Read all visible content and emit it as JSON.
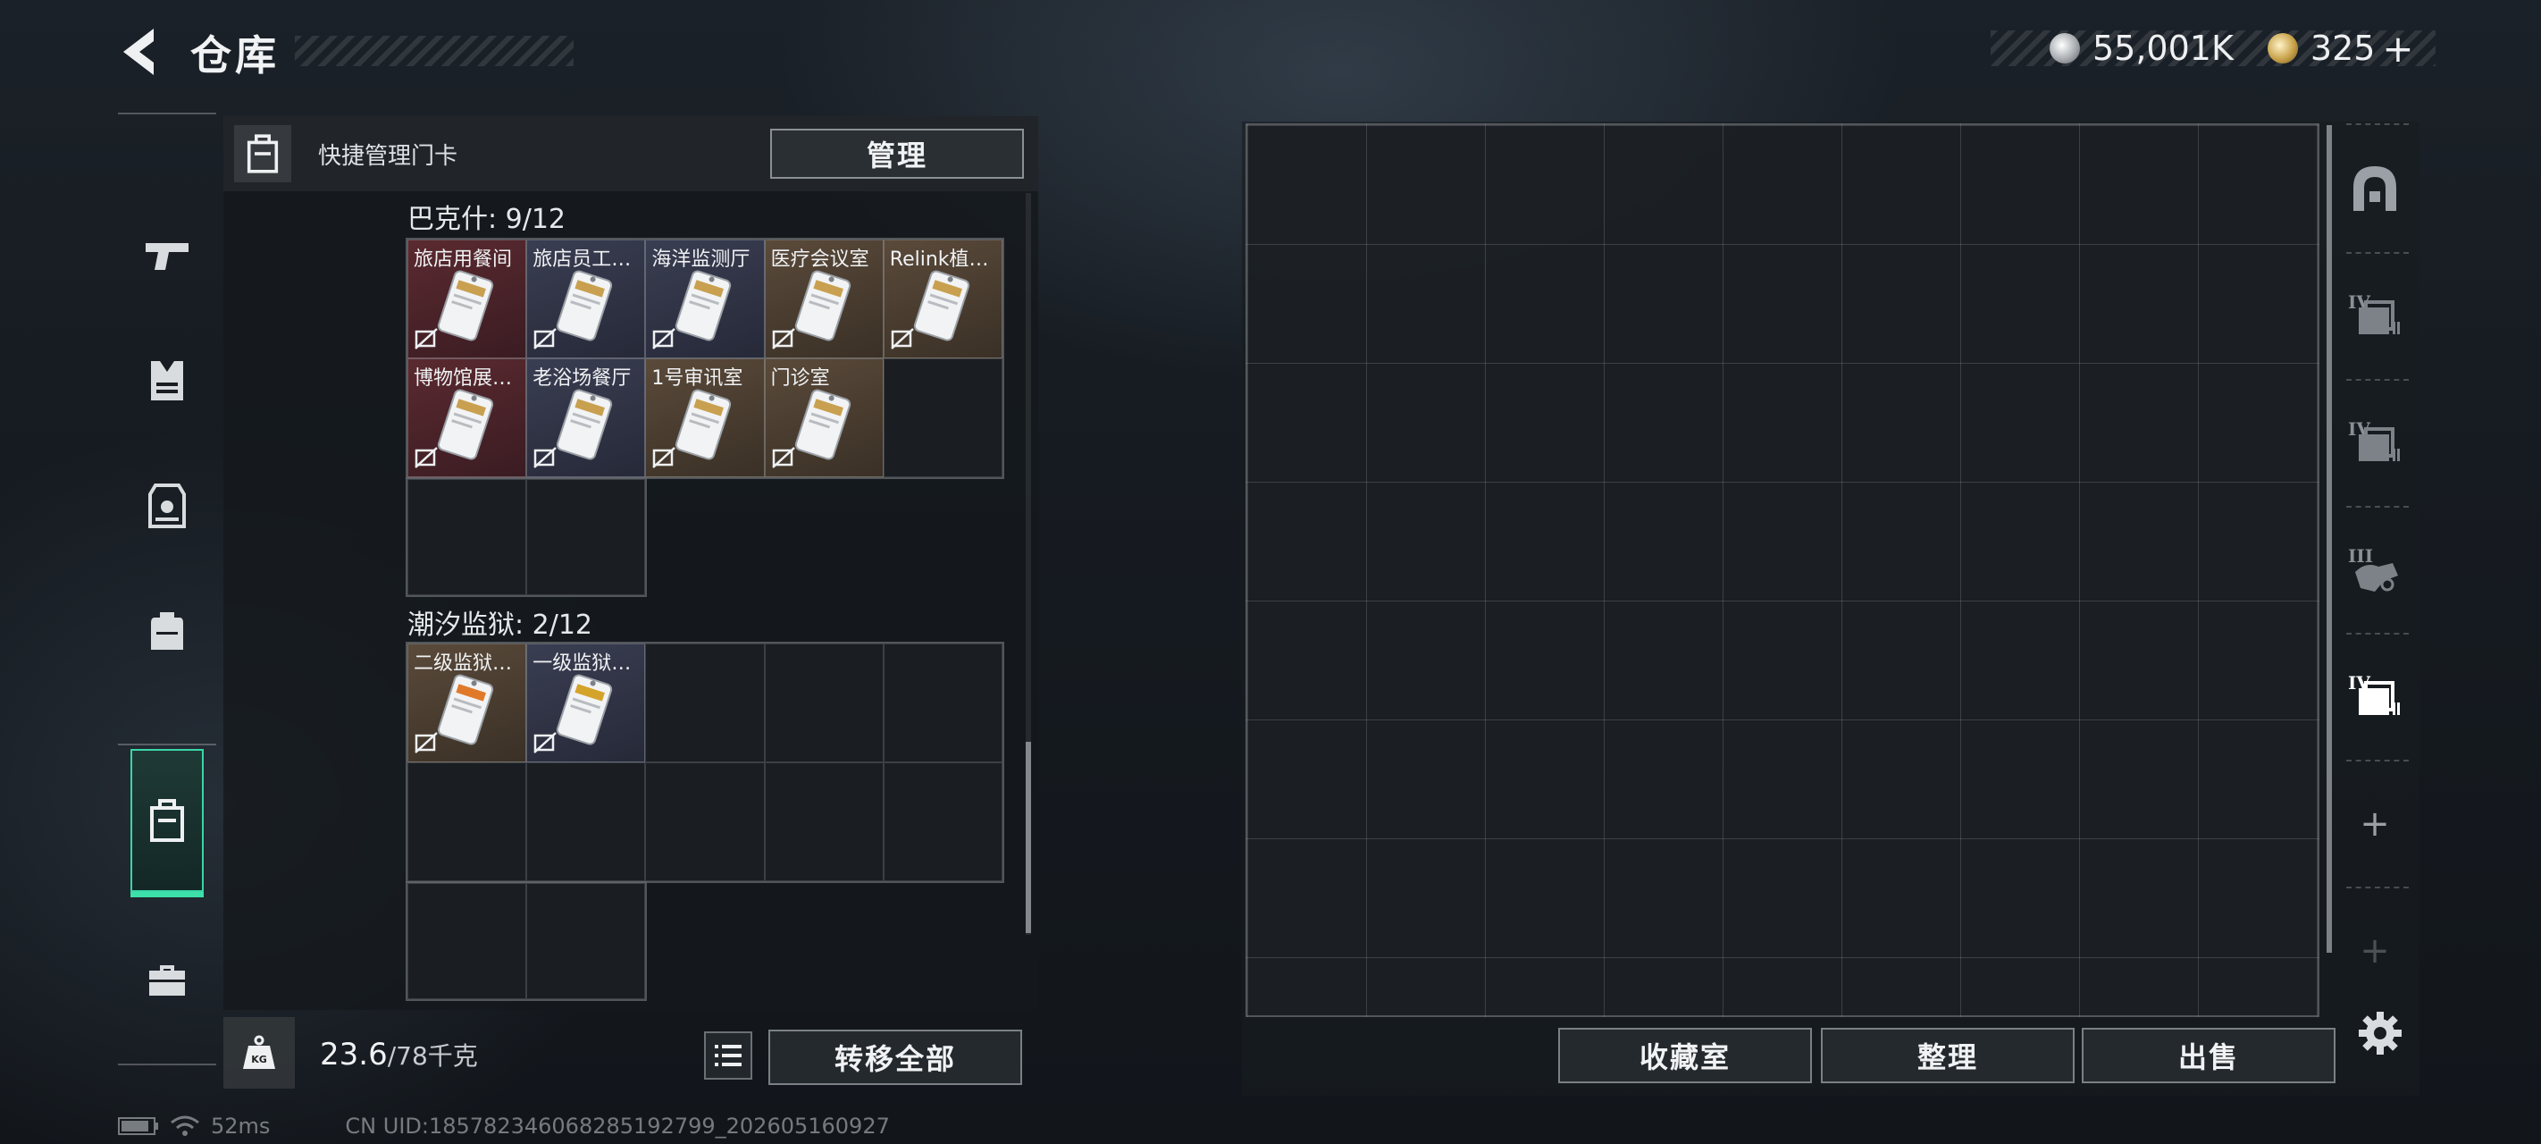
{
  "header": {
    "title": "仓库",
    "currency": {
      "silver": "55,001K",
      "gold": "325",
      "gold_add": "+"
    }
  },
  "left_nav": {
    "items": [
      {
        "icon": "pistol-icon"
      },
      {
        "icon": "vest-icon"
      },
      {
        "icon": "armor-plate-icon"
      },
      {
        "icon": "backpack-icon"
      },
      {
        "icon": "keycard-case-icon",
        "active": true
      },
      {
        "icon": "toolbox-icon"
      }
    ]
  },
  "inventory": {
    "header_label": "快捷管理门卡",
    "manage_label": "管理",
    "groups": [
      {
        "label": "巴克什: 9/12",
        "cards": [
          {
            "name": "旅店用餐间",
            "color": "red"
          },
          {
            "name": "旅店员工…",
            "color": "blue"
          },
          {
            "name": "海洋监测厅",
            "color": "blue"
          },
          {
            "name": "医疗会议室",
            "color": "brown"
          },
          {
            "name": "Relink植…",
            "color": "brown"
          },
          {
            "name": "博物馆展…",
            "color": "red"
          },
          {
            "name": "老浴场餐厅",
            "color": "blue"
          },
          {
            "name": "1号审讯室",
            "color": "brown"
          },
          {
            "name": "门诊室",
            "color": "brown"
          }
        ]
      },
      {
        "label": "潮汐监狱: 2/12",
        "cards": [
          {
            "name": "二级监狱…",
            "color": "brown"
          },
          {
            "name": "一级监狱…",
            "color": "blue"
          }
        ]
      }
    ],
    "weight": {
      "current": "23.6",
      "max": "/78千克"
    },
    "transfer_all_label": "转移全部"
  },
  "storage": {
    "buttons": {
      "collection": "收藏室",
      "organize": "整理",
      "sell": "出售"
    },
    "tabs": [
      {
        "icon": "stash-home-icon"
      },
      {
        "icon": "case-iv-icon",
        "roman": "IV"
      },
      {
        "icon": "case-iv-icon",
        "roman": "IV"
      },
      {
        "icon": "case-iii-icon",
        "roman": "III"
      },
      {
        "icon": "case-iv-icon",
        "roman": "IV",
        "active": true
      },
      {
        "icon": "plus-icon",
        "symbol": "+"
      },
      {
        "icon": "plus-icon",
        "symbol": "+"
      }
    ]
  },
  "status": {
    "ping": "52ms",
    "uid": "CN UID:185782346068285192799_202605160927"
  }
}
